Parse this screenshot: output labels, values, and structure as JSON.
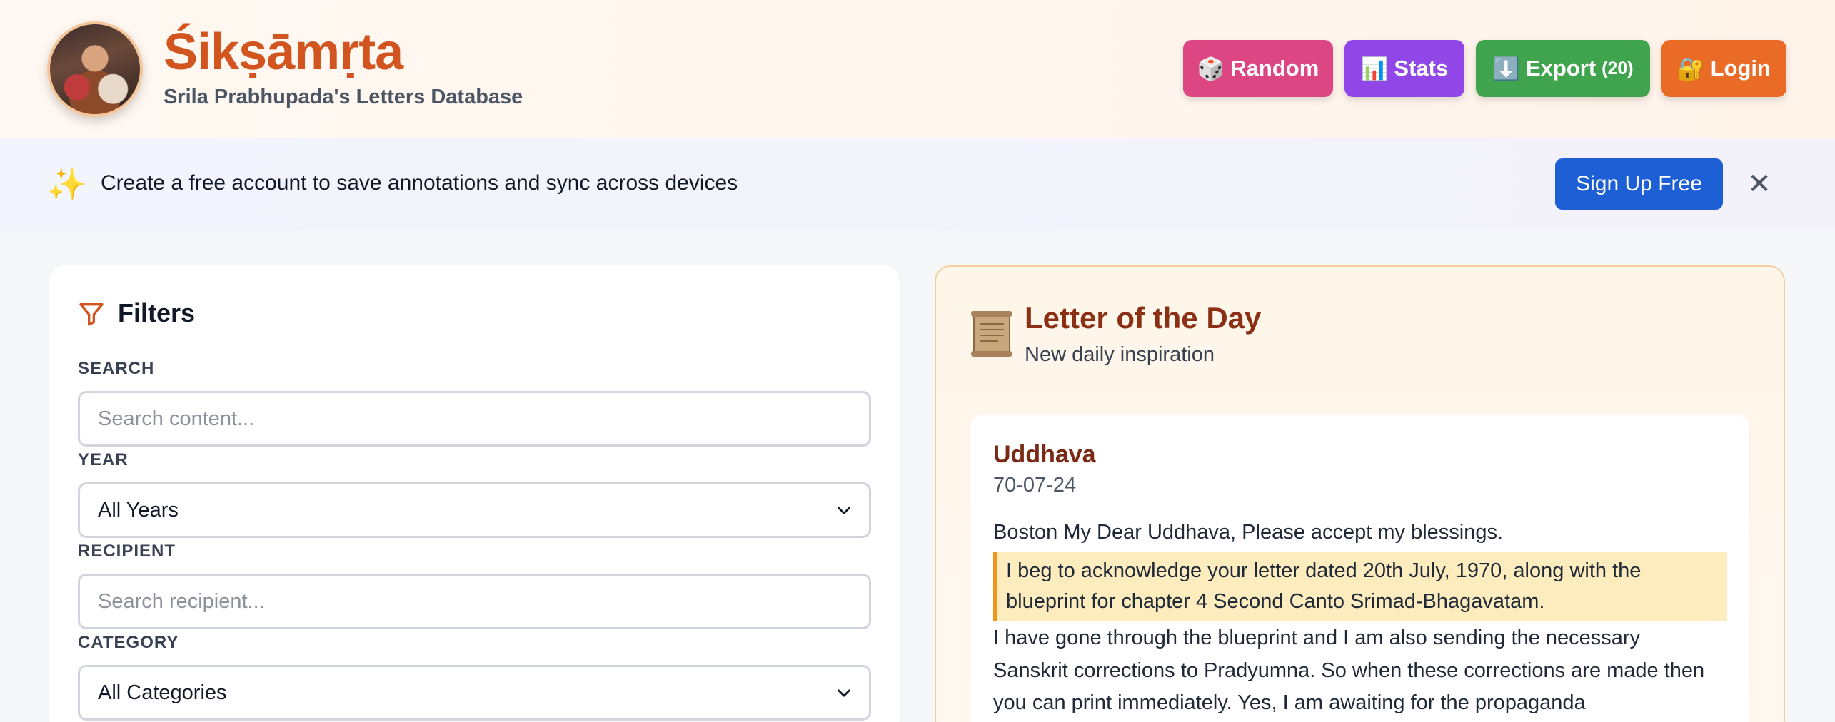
{
  "header": {
    "title": "Śikṣāmṛta",
    "subtitle": "Srila Prabhupada's Letters Database",
    "buttons": {
      "random": {
        "icon": "🎲",
        "label": "Random"
      },
      "stats": {
        "icon": "📊",
        "label": "Stats"
      },
      "export": {
        "icon": "⬇️",
        "label": "Export",
        "count": "(20)"
      },
      "login": {
        "icon": "🔐",
        "label": "Login"
      }
    }
  },
  "banner": {
    "icon": "✨",
    "text": "Create a free account to save annotations and sync across devices",
    "signup_label": "Sign Up Free",
    "close": "✕"
  },
  "filters": {
    "title": "Filters",
    "search": {
      "label": "SEARCH",
      "placeholder": "Search content..."
    },
    "year": {
      "label": "YEAR",
      "value": "All Years"
    },
    "recipient": {
      "label": "RECIPIENT",
      "placeholder": "Search recipient..."
    },
    "category": {
      "label": "CATEGORY",
      "value": "All Categories"
    }
  },
  "letter_of_the_day": {
    "title": "Letter of the Day",
    "subtitle": "New daily inspiration",
    "recipient": "Uddhava",
    "date": "70-07-24",
    "opening": "Boston My Dear Uddhava, Please accept my blessings.",
    "highlight_line1": "I beg to acknowledge your letter dated 20th July, 1970, along with the",
    "highlight_line2": "blueprint for chapter 4 Second Canto Srimad-Bhagavatam.",
    "body_line1": "I have gone through the blueprint and I am also sending the necessary",
    "body_line2": "Sanskrit corrections to Pradyumna. So when these corrections are made then",
    "body_line3": "you can print immediately. Yes, I am awaiting for the propaganda"
  },
  "colors": {
    "brand": "#d2541f",
    "random": "#dc4683",
    "stats": "#9146e8",
    "export": "#40a44f",
    "login": "#ea6b25",
    "signup": "#1e5fd6",
    "highlight_bg": "#fdecbe",
    "highlight_border": "#f0961f"
  }
}
